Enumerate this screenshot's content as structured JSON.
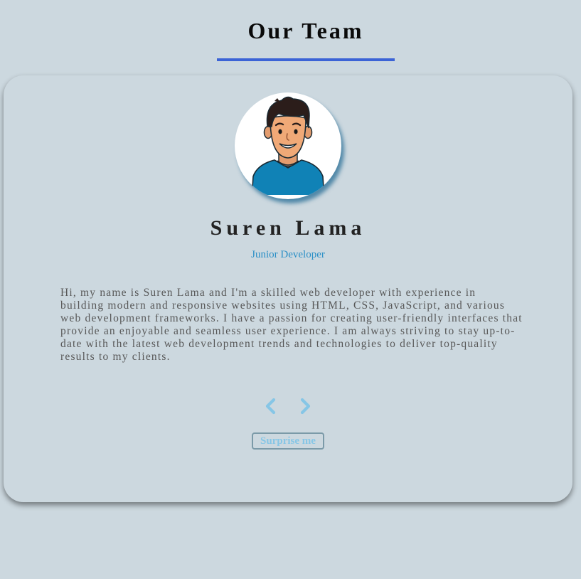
{
  "page": {
    "title": "Our Team"
  },
  "member": {
    "name": "Suren Lama",
    "job": "Junior Developer",
    "bio": "Hi, my name is Suren Lama and I'm a skilled web developer with experience in building modern and responsive websites using HTML, CSS, JavaScript, and various web development frameworks. I have a passion for creating user-friendly interfaces that provide an enjoyable and seamless user experience. I am always striving to stay up-to-date with the latest web development trends and technologies to deliver top-quality results to my clients.",
    "avatar_icon": "avatar-illustration"
  },
  "controls": {
    "prev_icon": "chevron-left-icon",
    "next_icon": "chevron-right-icon",
    "surprise_label": "Surprise me"
  },
  "colors": {
    "background": "#ccd8df",
    "accent_underline": "#3b63d6",
    "job_title": "#2a8fc6",
    "chevrons": "#86c6e6",
    "button_border": "#7b9aa8"
  }
}
